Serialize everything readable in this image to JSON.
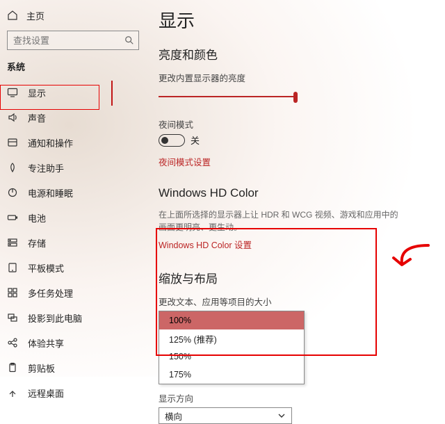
{
  "sidebar": {
    "home": "主页",
    "search_placeholder": "查找设置",
    "section": "系统",
    "items": [
      {
        "label": "显示"
      },
      {
        "label": "声音"
      },
      {
        "label": "通知和操作"
      },
      {
        "label": "专注助手"
      },
      {
        "label": "电源和睡眠"
      },
      {
        "label": "电池"
      },
      {
        "label": "存储"
      },
      {
        "label": "平板模式"
      },
      {
        "label": "多任务处理"
      },
      {
        "label": "投影到此电脑"
      },
      {
        "label": "体验共享"
      },
      {
        "label": "剪贴板"
      },
      {
        "label": "远程桌面"
      }
    ]
  },
  "content": {
    "title": "显示",
    "brightness": {
      "heading": "亮度和颜色",
      "slider_label": "更改内置显示器的亮度"
    },
    "nightlight": {
      "label": "夜间模式",
      "state": "关",
      "link": "夜间模式设置"
    },
    "hdcolor": {
      "heading": "Windows HD Color",
      "desc": "在上面所选择的显示器上让 HDR 和 WCG 视频、游戏和应用中的画面更明亮、更生动。",
      "link": "Windows HD Color 设置"
    },
    "scale": {
      "heading": "缩放与布局",
      "label": "更改文本、应用等项目的大小",
      "options": [
        "100%",
        "125% (推荐)",
        "150%",
        "175%"
      ],
      "selected": "100%",
      "orientation_label": "显示方向",
      "orientation_value": "横向"
    }
  }
}
